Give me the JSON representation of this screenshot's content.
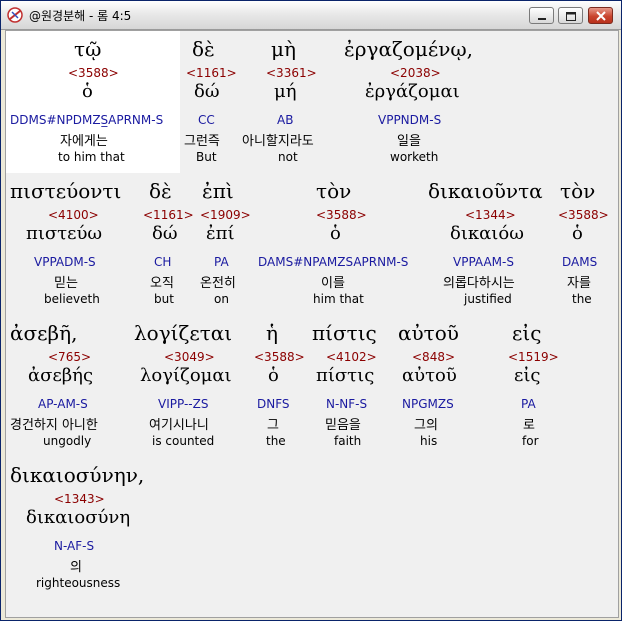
{
  "window": {
    "title": "@원경분해 - 롬 4:5",
    "buttons": [
      "minimize",
      "maximize",
      "close"
    ]
  },
  "rows": [
    [
      {
        "greek": "τῷ",
        "strong": "<3588>",
        "lemma": "ὁ",
        "parse": "DDMS#NPDMZS̲APRNM-S",
        "korean": "자에게는",
        "english": "to him that"
      },
      {
        "greek": "δὲ",
        "strong": "<1161>",
        "lemma": "δώ",
        "parse": "CC",
        "korean": "그런즉",
        "english": "But"
      },
      {
        "greek": "μὴ",
        "strong": "<3361>",
        "lemma": "μή",
        "parse": "AB",
        "korean": "아니할지라도",
        "english": "not"
      },
      {
        "greek": "ἐργαζομένῳ,",
        "strong": "<2038>",
        "lemma": "ἐργάζομαι",
        "parse": "VPPNDM-S",
        "korean": "일을",
        "english": "worketh"
      }
    ],
    [
      {
        "greek": "πιστεύοντι",
        "strong": "<4100>",
        "lemma": "πιστεύω",
        "parse": "VPPADM-S",
        "korean": "믿는",
        "english": "believeth"
      },
      {
        "greek": "δὲ",
        "strong": "<1161>",
        "lemma": "δώ",
        "parse": "CH",
        "korean": "오직",
        "english": "but"
      },
      {
        "greek": "ἐπὶ",
        "strong": "<1909>",
        "lemma": "ἐπί",
        "parse": "PA",
        "korean": "온전히",
        "english": "on"
      },
      {
        "greek": "τὸν",
        "strong": "<3588>",
        "lemma": "ὁ",
        "parse": "DAMS#NPAMZSAPRNM-S",
        "korean": "이를",
        "english": "him that"
      },
      {
        "greek": "δικαιοῦντα",
        "strong": "<1344>",
        "lemma": "δικαιόω",
        "parse": "VPPAAM-S",
        "korean": "의롭다하시는",
        "english": "justified"
      },
      {
        "greek": "τὸν",
        "strong": "<3588>",
        "lemma": "ὁ",
        "parse": "DAMS",
        "korean": "자를",
        "english": "the"
      }
    ],
    [
      {
        "greek": "ἀσεβῆ,",
        "strong": "<765>",
        "lemma": "ἀσεβής",
        "parse": "AP-AM-S",
        "korean": "경건하지 아니한",
        "english": "ungodly"
      },
      {
        "greek": "λογίζεται",
        "strong": "<3049>",
        "lemma": "λογίζομαι",
        "parse": "VIPP--ZS",
        "korean": "여기시나니",
        "english": "is counted"
      },
      {
        "greek": "ἡ",
        "strong": "<3588>",
        "lemma": "ὁ",
        "parse": "DNFS",
        "korean": "그",
        "english": "the"
      },
      {
        "greek": "πίστις",
        "strong": "<4102>",
        "lemma": "πίστις",
        "parse": "N-NF-S",
        "korean": "믿음을",
        "english": "faith"
      },
      {
        "greek": "αὐτοῦ",
        "strong": "<848>",
        "lemma": "αὐτοῦ",
        "parse": "NPGMZS",
        "korean": "그의",
        "english": "his"
      },
      {
        "greek": "εἰς",
        "strong": "<1519>",
        "lemma": "εἰς",
        "parse": "PA",
        "korean": "로",
        "english": "for"
      }
    ],
    [
      {
        "greek": "δικαιοσύνην,",
        "strong": "<1343>",
        "lemma": "δικαιοσύνη",
        "parse": "N-AF-S",
        "korean": "의",
        "english": "righteousness"
      }
    ]
  ]
}
